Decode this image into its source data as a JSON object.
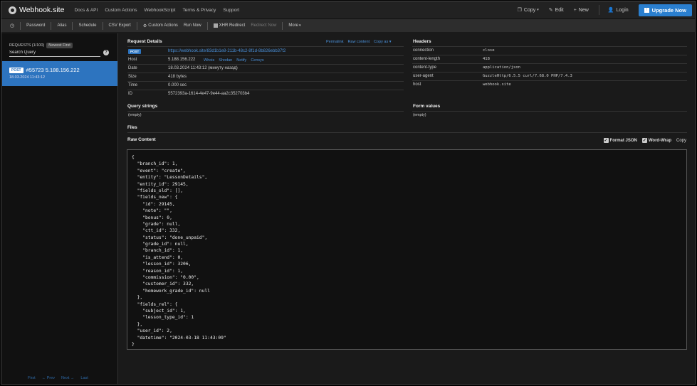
{
  "navbar": {
    "brand": "Webhook.site",
    "links": [
      "Docs & API",
      "Custom Actions",
      "WebhookScript",
      "Terms & Privacy",
      "Support"
    ],
    "copy": "Copy",
    "edit": "Edit",
    "new": "New",
    "login": "Login",
    "upgrade": "Upgrade Now"
  },
  "toolbar": {
    "password": "Password",
    "alias": "Alias",
    "schedule": "Schedule",
    "csv_export": "CSV Export",
    "custom_actions": "Custom Actions",
    "run_now": "Run Now",
    "xhr_redirect": "XHR Redirect",
    "redirect_now": "Redirect Now",
    "more": "More"
  },
  "sidebar": {
    "requests_label": "REQUESTS (1/100)",
    "newest_first": "Newest First",
    "search_placeholder": "Search Query",
    "request": {
      "method": "POST",
      "title": "#55723 5.188.156.222",
      "date": "18.03.2024 11:43:12"
    },
    "pager": [
      "First",
      "← Prev",
      "Next →",
      "Last"
    ]
  },
  "request_details": {
    "title": "Request Details",
    "actions": [
      "Permalink",
      "Raw content",
      "Copy as ▾"
    ],
    "method": "POST",
    "url": "https://webhook.site/83d1b1e8-211b-48c2-8f1d-8b826ebb37f2",
    "host_label": "Host",
    "host_value": "5.188.156.222",
    "host_links": [
      "Whois",
      "Shodan",
      "Netify",
      "Censys"
    ],
    "date_label": "Date",
    "date_value": "18.03.2024 11:43:12 (минуту назад)",
    "size_label": "Size",
    "size_value": "418 bytes",
    "time_label": "Time",
    "time_value": "0.000 sec",
    "id_label": "ID",
    "id_value": "5572393a-1614-4e47-9e44-aa2c352703b4"
  },
  "headers": {
    "title": "Headers",
    "rows": [
      {
        "name": "connection",
        "value": "close"
      },
      {
        "name": "content-length",
        "value": "418"
      },
      {
        "name": "content-type",
        "value": "application/json"
      },
      {
        "name": "user-agent",
        "value": "GuzzleHttp/6.5.5 curl/7.68.0 PHP/7.4.3"
      },
      {
        "name": "host",
        "value": "webhook.site"
      }
    ]
  },
  "query_strings": {
    "title": "Query strings",
    "value": "(empty)"
  },
  "form_values": {
    "title": "Form values",
    "value": "(empty)"
  },
  "files": {
    "title": "Files"
  },
  "raw_content": {
    "title": "Raw Content",
    "format_json": "Format JSON",
    "word_wrap": "Word-Wrap",
    "copy": "Copy",
    "lines": [
      "{",
      "  \"branch_id\": 1,",
      "  \"event\": \"create\",",
      "  \"entity\": \"LessonDetails\",",
      "  \"entity_id\": 29145,",
      "  \"fields_old\": [],",
      "  \"fields_new\": {",
      "    \"id\": 29145,",
      "    \"note\": \"\",",
      "    \"bonus\": 0,",
      "    \"grade\": null,",
      "    \"ctt_id\": 332,",
      "    \"status\": \"done_unpaid\",",
      "    \"grade_id\": null,",
      "    \"branch_id\": 1,",
      "    \"is_attend\": 0,",
      "    \"lesson_id\": 3206,",
      "    \"reason_id\": 1,",
      "    \"commission\": \"0.00\",",
      "    \"customer_id\": 332,",
      "    \"homework_grade_id\": null",
      "  },",
      "  \"fields_rel\": {",
      "    \"subject_id\": 1,",
      "    \"lesson_type_id\": 1",
      "  },",
      "  \"user_id\": 2,",
      "  \"datetime\": \"2024-03-18 11:43:09\"",
      "}"
    ]
  }
}
